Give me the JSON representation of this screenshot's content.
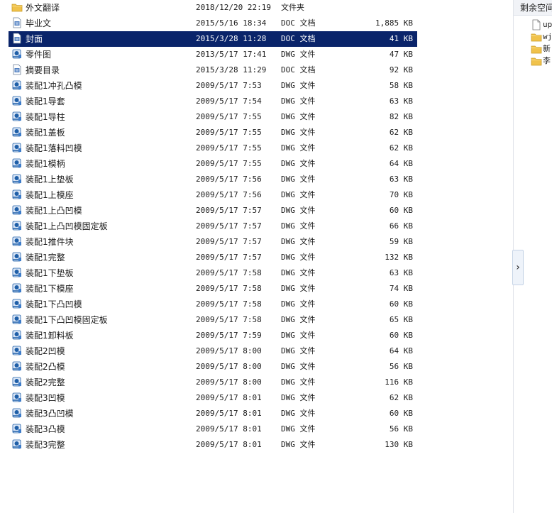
{
  "file_list": {
    "rows": [
      {
        "name": "外文翻译",
        "date": "2018/12/20 22:19",
        "type": "文件夹",
        "size": "",
        "icon": "folder-icon",
        "selected": false
      },
      {
        "name": "毕业文",
        "date": "2015/5/16 18:34",
        "type": "DOC 文档",
        "size": "1,885 KB",
        "icon": "doc-icon",
        "selected": false
      },
      {
        "name": "封面",
        "date": "2015/3/28 11:28",
        "type": "DOC 文档",
        "size": "41 KB",
        "icon": "doc-icon",
        "selected": true
      },
      {
        "name": "零件图",
        "date": "2013/5/17 17:41",
        "type": "DWG 文件",
        "size": "47 KB",
        "icon": "dwg-icon",
        "selected": false
      },
      {
        "name": "摘要目录",
        "date": "2015/3/28 11:29",
        "type": "DOC 文档",
        "size": "92 KB",
        "icon": "doc-icon",
        "selected": false
      },
      {
        "name": "装配1冲孔凸模",
        "date": "2009/5/17 7:53",
        "type": "DWG 文件",
        "size": "58 KB",
        "icon": "dwg-icon",
        "selected": false
      },
      {
        "name": "装配1导套",
        "date": "2009/5/17 7:54",
        "type": "DWG 文件",
        "size": "63 KB",
        "icon": "dwg-icon",
        "selected": false
      },
      {
        "name": "装配1导柱",
        "date": "2009/5/17 7:55",
        "type": "DWG 文件",
        "size": "82 KB",
        "icon": "dwg-icon",
        "selected": false
      },
      {
        "name": "装配1盖板",
        "date": "2009/5/17 7:55",
        "type": "DWG 文件",
        "size": "62 KB",
        "icon": "dwg-icon",
        "selected": false
      },
      {
        "name": "装配1落料凹模",
        "date": "2009/5/17 7:55",
        "type": "DWG 文件",
        "size": "62 KB",
        "icon": "dwg-icon",
        "selected": false
      },
      {
        "name": "装配1模柄",
        "date": "2009/5/17 7:55",
        "type": "DWG 文件",
        "size": "64 KB",
        "icon": "dwg-icon",
        "selected": false
      },
      {
        "name": "装配1上垫板",
        "date": "2009/5/17 7:56",
        "type": "DWG 文件",
        "size": "63 KB",
        "icon": "dwg-icon",
        "selected": false
      },
      {
        "name": "装配1上模座",
        "date": "2009/5/17 7:56",
        "type": "DWG 文件",
        "size": "70 KB",
        "icon": "dwg-icon",
        "selected": false
      },
      {
        "name": "装配1上凸凹模",
        "date": "2009/5/17 7:57",
        "type": "DWG 文件",
        "size": "60 KB",
        "icon": "dwg-icon",
        "selected": false
      },
      {
        "name": "装配1上凸凹模固定板",
        "date": "2009/5/17 7:57",
        "type": "DWG 文件",
        "size": "66 KB",
        "icon": "dwg-icon",
        "selected": false
      },
      {
        "name": "装配1推件块",
        "date": "2009/5/17 7:57",
        "type": "DWG 文件",
        "size": "59 KB",
        "icon": "dwg-icon",
        "selected": false
      },
      {
        "name": "装配1完整",
        "date": "2009/5/17 7:57",
        "type": "DWG 文件",
        "size": "132 KB",
        "icon": "dwg-icon",
        "selected": false
      },
      {
        "name": "装配1下垫板",
        "date": "2009/5/17 7:58",
        "type": "DWG 文件",
        "size": "63 KB",
        "icon": "dwg-icon",
        "selected": false
      },
      {
        "name": "装配1下模座",
        "date": "2009/5/17 7:58",
        "type": "DWG 文件",
        "size": "74 KB",
        "icon": "dwg-icon",
        "selected": false
      },
      {
        "name": "装配1下凸凹模",
        "date": "2009/5/17 7:58",
        "type": "DWG 文件",
        "size": "60 KB",
        "icon": "dwg-icon",
        "selected": false
      },
      {
        "name": "装配1下凸凹模固定板",
        "date": "2009/5/17 7:58",
        "type": "DWG 文件",
        "size": "65 KB",
        "icon": "dwg-icon",
        "selected": false
      },
      {
        "name": "装配1卸料板",
        "date": "2009/5/17 7:59",
        "type": "DWG 文件",
        "size": "60 KB",
        "icon": "dwg-icon",
        "selected": false
      },
      {
        "name": "装配2凹模",
        "date": "2009/5/17 8:00",
        "type": "DWG 文件",
        "size": "64 KB",
        "icon": "dwg-icon",
        "selected": false
      },
      {
        "name": "装配2凸模",
        "date": "2009/5/17 8:00",
        "type": "DWG 文件",
        "size": "56 KB",
        "icon": "dwg-icon",
        "selected": false
      },
      {
        "name": "装配2完整",
        "date": "2009/5/17 8:00",
        "type": "DWG 文件",
        "size": "116 KB",
        "icon": "dwg-icon",
        "selected": false
      },
      {
        "name": "装配3凹模",
        "date": "2009/5/17 8:01",
        "type": "DWG 文件",
        "size": "62 KB",
        "icon": "dwg-icon",
        "selected": false
      },
      {
        "name": "装配3凸凹模",
        "date": "2009/5/17 8:01",
        "type": "DWG 文件",
        "size": "60 KB",
        "icon": "dwg-icon",
        "selected": false
      },
      {
        "name": "装配3凸模",
        "date": "2009/5/17 8:01",
        "type": "DWG 文件",
        "size": "56 KB",
        "icon": "dwg-icon",
        "selected": false
      },
      {
        "name": "装配3完整",
        "date": "2009/5/17 8:01",
        "type": "DWG 文件",
        "size": "130 KB",
        "icon": "dwg-icon",
        "selected": false
      }
    ]
  },
  "right_panel": {
    "header": "剩余空间",
    "items": [
      {
        "label": "up",
        "icon": "file-icon"
      },
      {
        "label": "wj",
        "icon": "folder-icon"
      },
      {
        "label": "新",
        "icon": "folder-icon"
      },
      {
        "label": "李",
        "icon": "folder-icon"
      }
    ]
  },
  "collapse_handle": {
    "icon": "chevron-right-icon",
    "glyph": "›"
  },
  "colors": {
    "selection": "#0a246a",
    "folder": "#f0c24b",
    "doc_icon": "#4f7fc2",
    "dwg_icon": "#1f5fa8"
  }
}
